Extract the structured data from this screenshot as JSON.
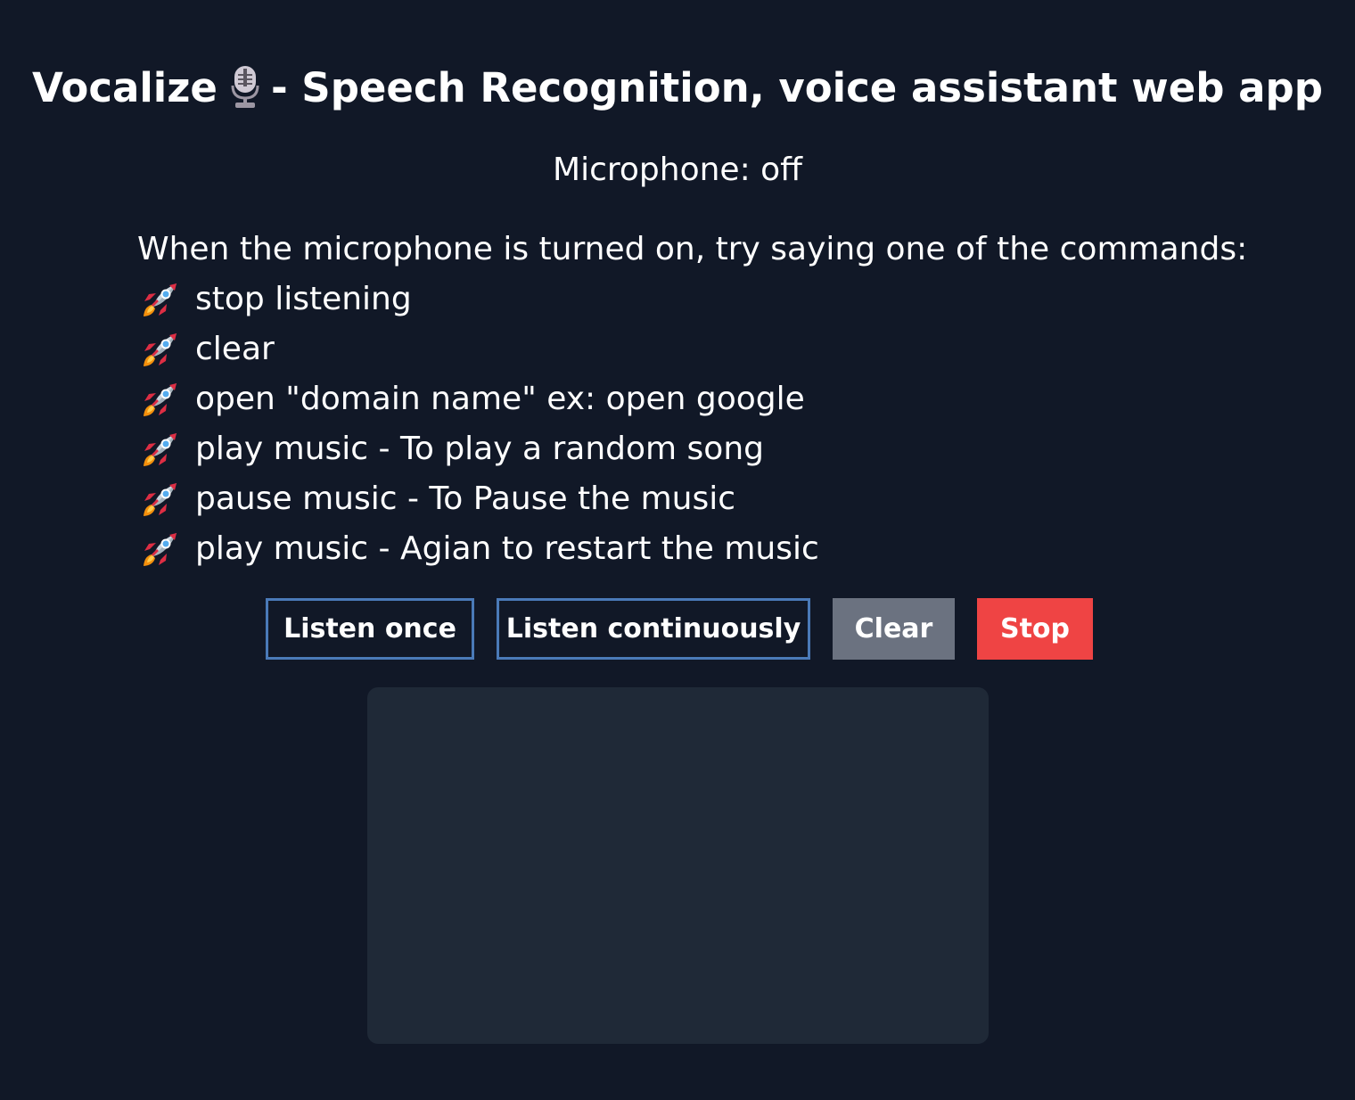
{
  "header": {
    "title_prefix": "Vocalize",
    "title_suffix": "- Speech Recognition, voice assistant web app",
    "icon": "microphone-icon"
  },
  "microphone": {
    "status_text": "Microphone: off"
  },
  "commands": {
    "intro": "When the microphone is turned on, try saying one of the commands:",
    "bullet_icon": "rocket-icon",
    "items": [
      {
        "label": "stop listening"
      },
      {
        "label": "clear"
      },
      {
        "label": "open \"domain name\" ex: open google"
      },
      {
        "label": "play music - To play a random song"
      },
      {
        "label": "pause music - To Pause the music"
      },
      {
        "label": "play music - Agian to restart the music"
      }
    ]
  },
  "buttons": {
    "listen_once": "Listen once",
    "listen_continuously": "Listen continuously",
    "clear": "Clear",
    "stop": "Stop"
  },
  "transcript": {
    "text": ""
  },
  "colors": {
    "background": "#111827",
    "panel": "#1f2937",
    "outline_button_border": "#4a7ab8",
    "clear_button": "#6b7280",
    "stop_button": "#ef4444"
  }
}
